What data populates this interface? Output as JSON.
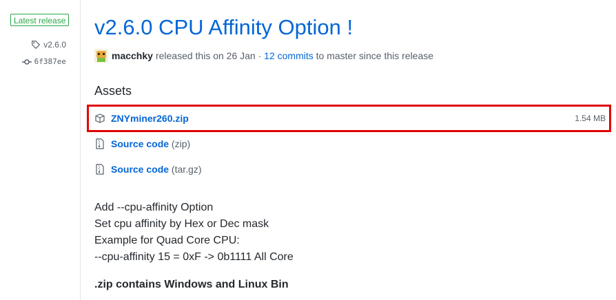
{
  "sidebar": {
    "badge": "Latest release",
    "tag": "v2.6.0",
    "commit": "6f387ee"
  },
  "release": {
    "title": "v2.6.0 CPU Affinity Option !",
    "author": "macchky",
    "released_text": "released this on 26 Jan",
    "separator": "·",
    "commits_link": "12 commits",
    "commits_suffix": "to master since this release"
  },
  "assets": {
    "heading": "Assets",
    "items": [
      {
        "name": "ZNYminer260.zip",
        "ext": "",
        "size": "1.54 MB",
        "icon": "package-icon"
      },
      {
        "name": "Source code",
        "ext": "(zip)",
        "size": "",
        "icon": "file-zip-icon"
      },
      {
        "name": "Source code",
        "ext": "(tar.gz)",
        "size": "",
        "icon": "file-zip-icon"
      }
    ],
    "highlight_color": "#e00000"
  },
  "notes": {
    "lines": [
      "Add --cpu-affinity Option",
      "Set cpu affinity by Hex or Dec mask",
      "Example for Quad Core CPU:",
      "--cpu-affinity 15 = 0xF -> 0b1111 All Core"
    ],
    "bold_line": ".zip contains Windows and Linux Bin"
  },
  "colors": {
    "link": "#0366d6",
    "badge_green": "#28a745",
    "muted": "#586069",
    "text": "#24292e"
  }
}
